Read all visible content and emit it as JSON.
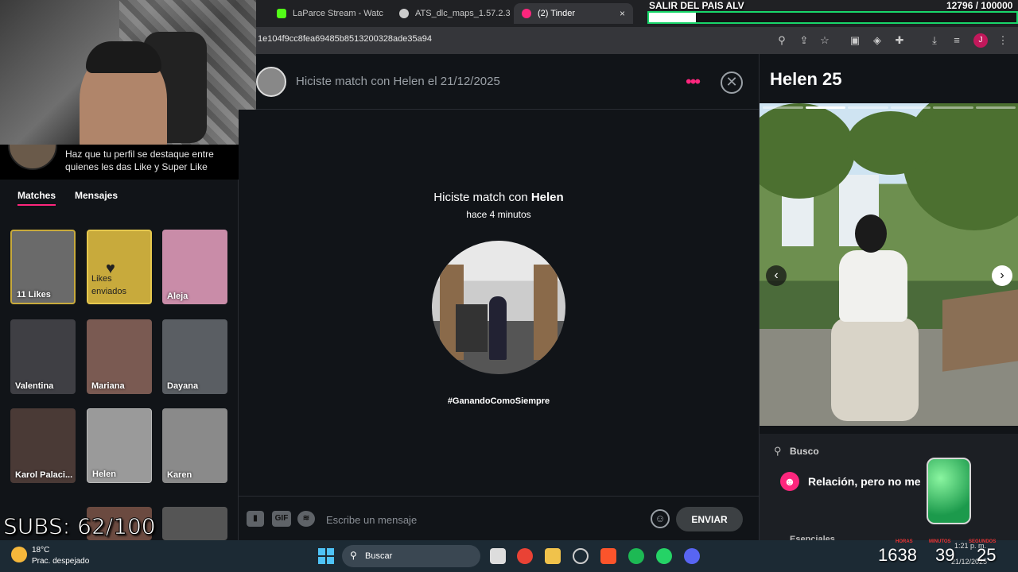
{
  "browser": {
    "tabs": [
      {
        "label": "LaParce Stream - Watc",
        "favicon_color": "#53fc18"
      },
      {
        "label": "ATS_dlc_maps_1.57.2.3",
        "favicon_color": "#cccccc"
      },
      {
        "label": "(2) Tinder",
        "favicon_color": "#fd267d",
        "active": true
      }
    ],
    "url": "1e104f9cc8fea69485b8513200328ade35a94"
  },
  "overlay": {
    "title": "SALIR DEL PAIS ALV",
    "counter": "12796 / 100000",
    "progress_fraction": 0.128,
    "subs": "SUBS: 62/100",
    "timer_labels": [
      "HORAS",
      "MINUTOS",
      "SEGUNDOS"
    ],
    "timer_values": [
      "1638",
      "39",
      "25"
    ]
  },
  "sidebar": {
    "promo_text": "Haz que tu perfil se destaque entre quienes les das Like y Super Like",
    "tabs": {
      "matches": "Matches",
      "messages": "Mensajes"
    },
    "likes_label": "11 Likes",
    "sent_label": "Likes enviados",
    "matches": [
      {
        "name": "Aleja",
        "color": "#c98ca8"
      },
      {
        "name": "Valentina",
        "color": "#3f3f44"
      },
      {
        "name": "Mariana",
        "color": "#7a5a52"
      },
      {
        "name": "Dayana",
        "color": "#5a5e63"
      },
      {
        "name": "Karol Palaci...",
        "color": "#4a3a36"
      },
      {
        "name": "Helen",
        "color": "#9a9a9a"
      },
      {
        "name": "Karen",
        "color": "#8a8a8a"
      }
    ]
  },
  "chat": {
    "header_title": "Hiciste match con Helen el 21/12/2025",
    "match_prefix": "Hiciste match con ",
    "match_name": "Helen",
    "match_time": "hace 4 minutos",
    "hashtag": "#GanandoComoSiempre",
    "composer_placeholder": "Escribe un mensaje",
    "gif_label": "GIF",
    "send_label": "ENVIAR"
  },
  "profile": {
    "name": "Helen 25",
    "photo_count": 6,
    "photo_index": 1,
    "busco_label": "Busco",
    "busco_value": "Relación, pero no me",
    "section_next": "Esenciales"
  },
  "taskbar": {
    "temp": "18°C",
    "weather": "Prac. despejado",
    "search_label": "Buscar",
    "time": "1:21 p. m.",
    "date": "21/12/2025"
  }
}
